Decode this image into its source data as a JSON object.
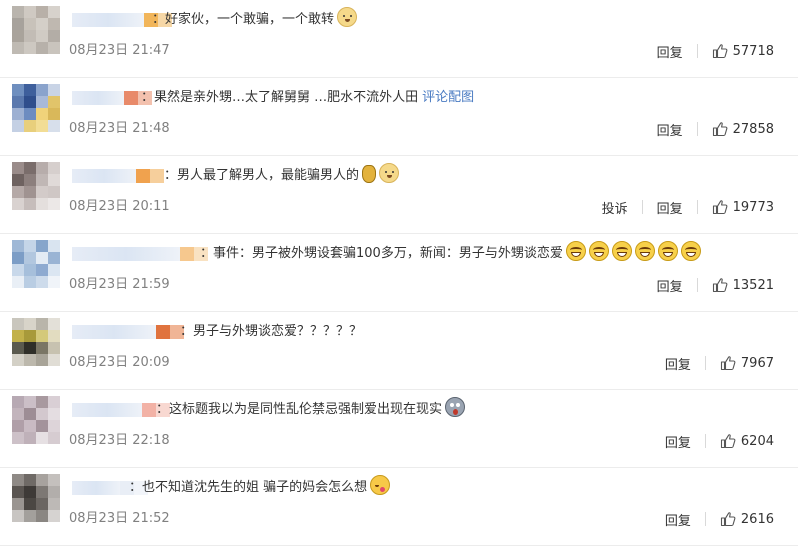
{
  "separator": "：",
  "reply_label": "回复",
  "report_label": "投诉",
  "comments": [
    {
      "text": "好家伙，一个敢骗，一个敢转",
      "emojis": [
        "dog"
      ],
      "link": "",
      "date": "08月23日",
      "time": "21:47",
      "likes": "57718",
      "avatar_colors": [
        "#b9b4ad",
        "#cfc9c2",
        "#b8b0a8",
        "#d7d2cc",
        "#a7a29c",
        "#c8c2ba",
        "#d4cfc8",
        "#bfb8b0",
        "#a9a39b",
        "#c2bcb5",
        "#d0cbc4",
        "#b3ada6",
        "#bfbab3",
        "#cdc8c1",
        "#b7b1aa",
        "#c9c4bd"
      ],
      "name_blur_width": 72,
      "name_accent": [
        "#f1b55a",
        "#f6d7a6"
      ]
    },
    {
      "text": "果然是亲外甥…太了解舅舅 …肥水不流外人田",
      "emojis": [],
      "link": "评论配图",
      "date": "08月23日",
      "time": "21:48",
      "likes": "27858",
      "avatar_colors": [
        "#6f8fbf",
        "#3e5f9c",
        "#8aa3cc",
        "#c9d4e6",
        "#5b79ae",
        "#2f4e8c",
        "#a8b9d8",
        "#e1c46a",
        "#9db0d2",
        "#6d8cc0",
        "#f0d37a",
        "#d9b85a",
        "#c4d0e4",
        "#e8cf7c",
        "#f2dd95",
        "#d7dfeb"
      ],
      "name_blur_width": 52,
      "name_accent": [
        "#e88a6a",
        "#f3c1ae"
      ]
    },
    {
      "text": "男人最了解男人，最能骗男人的",
      "emojis": [
        "bag",
        "dog"
      ],
      "link": "",
      "date": "08月23日",
      "time": "20:11",
      "likes": "19773",
      "avatar_colors": [
        "#9a8c8a",
        "#7a6d6b",
        "#b7adab",
        "#d6cfcd",
        "#6e6260",
        "#8c7f7d",
        "#c0b7b5",
        "#e0dad8",
        "#b5a9a7",
        "#a09391",
        "#d3cbc9",
        "#cfc7c5",
        "#d9d2d0",
        "#c6bdbb",
        "#e4dfdd",
        "#ece8e7"
      ],
      "name_blur_width": 64,
      "name_accent": [
        "#f0a24e",
        "#f6cf9c"
      ]
    },
    {
      "text": "事件：男子被外甥设套骗100多万，新闻：男子与外甥谈恋爱",
      "emojis": [
        "laugh",
        "laugh",
        "laugh",
        "laugh",
        "laugh",
        "laugh"
      ],
      "link": "",
      "date": "08月23日",
      "time": "21:59",
      "likes": "13521",
      "avatar_colors": [
        "#9fb8d6",
        "#c4d5e8",
        "#86a5cb",
        "#d9e4f0",
        "#7c9dc6",
        "#b2c7df",
        "#e3ebf4",
        "#9ab4d4",
        "#c8d8ea",
        "#a6bfdb",
        "#8eaad0",
        "#dbe6f2",
        "#e9eff6",
        "#b9cde3",
        "#cddbeb",
        "#f0f4f9"
      ],
      "name_blur_width": 108,
      "name_accent": [
        "#f6c88e",
        "#f9e2c2"
      ]
    },
    {
      "text": "男子与外甥谈恋爱？？？？？",
      "emojis": [],
      "link": "",
      "date": "08月23日",
      "time": "20:09",
      "likes": "7967",
      "avatar_colors": [
        "#c9c6bd",
        "#d8d4c9",
        "#b9b5aa",
        "#e3e0d8",
        "#c2b14a",
        "#a89a3a",
        "#d4c97a",
        "#e2dcc0",
        "#5a5a4e",
        "#2f2f28",
        "#7a7665",
        "#c7c2b0",
        "#d3d0c6",
        "#bcb8ac",
        "#a8a498",
        "#e0ddd5"
      ],
      "name_blur_width": 84,
      "name_accent": [
        "#e0733e",
        "#f0b596"
      ]
    },
    {
      "text": "这标题我以为是同性乱伦禁忌强制爱出现在现实",
      "emojis": [
        "shock"
      ],
      "link": "",
      "date": "08月23日",
      "time": "22:18",
      "likes": "6204",
      "avatar_colors": [
        "#b7a9b3",
        "#cbbfc7",
        "#a8999f",
        "#d9cfd5",
        "#c2b4bc",
        "#9d8d95",
        "#d3c8ce",
        "#e4dde1",
        "#b09fa8",
        "#c9bbc3",
        "#a3939b",
        "#ddd4d9",
        "#cdc1c8",
        "#bfb1b9",
        "#e6e0e3",
        "#d6ccd1"
      ],
      "name_blur_width": 70,
      "name_accent": [
        "#f2b2a6",
        "#f8d8d1"
      ]
    },
    {
      "text": "也不知道沈先生的姐 骗子的妈会怎么想",
      "emojis": [
        "kiss"
      ],
      "link": "",
      "date": "08月23日",
      "time": "21:52",
      "likes": "2616",
      "avatar_colors": [
        "#8f8a86",
        "#6f6a66",
        "#a7a29e",
        "#c4c0bd",
        "#5a5551",
        "#3e3a37",
        "#7d7874",
        "#b2aeab",
        "#9a9591",
        "#4b4743",
        "#6a6561",
        "#bdb9b6",
        "#c8c5c2",
        "#a3a09c",
        "#8a8682",
        "#d6d3d1"
      ],
      "name_blur_width": 48,
      "name_accent": [
        "#e9eef6",
        "#f2f5fa"
      ]
    }
  ]
}
